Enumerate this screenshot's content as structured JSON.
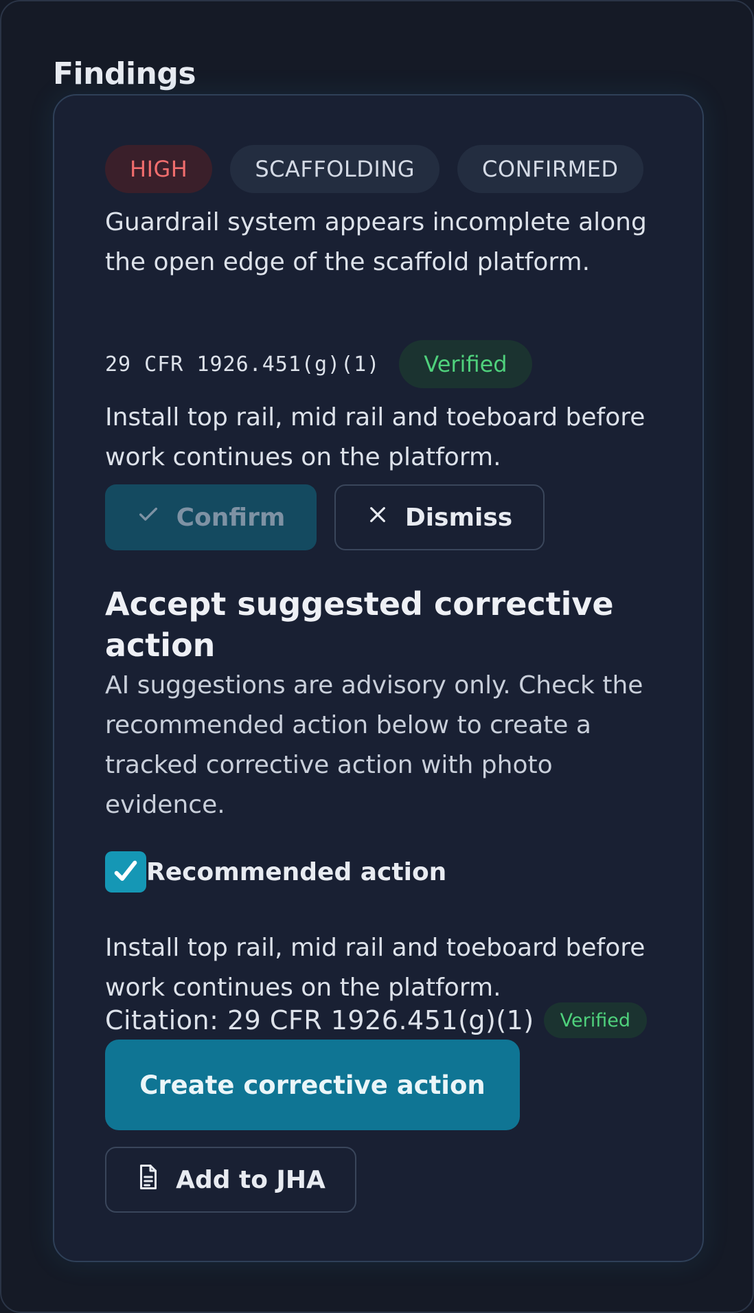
{
  "section": {
    "title": "Findings"
  },
  "finding": {
    "badges": {
      "severity": "HIGH",
      "category": "SCAFFOLDING",
      "status": "CONFIRMED"
    },
    "description": "Guardrail system appears incomplete along the open edge of the scaffold platform.",
    "citation": "29 CFR 1926.451(g)(1)",
    "citation_status": "Verified",
    "recommendation": "Install top rail, mid rail and toeboard before work continues on the platform.",
    "actions": {
      "confirm_label": "Confirm",
      "dismiss_label": "Dismiss"
    }
  },
  "corrective": {
    "heading": "Accept suggested corrective action",
    "disclaimer": "AI suggestions are advisory only. Check the recommended action below to create a tracked corrective action with photo evidence.",
    "checkbox_label": "Recommended action",
    "checkbox_checked": true,
    "action_text": "Install top rail, mid rail and toeboard before work continues on the platform.",
    "citation_line": "Citation: 29 CFR 1926.451(g)(1)",
    "citation_status": "Verified",
    "create_label": "Create corrective action",
    "jha_label": "Add to JHA"
  },
  "colors": {
    "accent": "#0f7594",
    "severity_high": "#f06d6d",
    "verified": "#4fd17c",
    "checkbox": "#1597b5"
  },
  "icons": {
    "confirm": "check-icon",
    "dismiss": "close-icon",
    "checkbox": "checkmark-icon",
    "jha": "document-icon"
  }
}
